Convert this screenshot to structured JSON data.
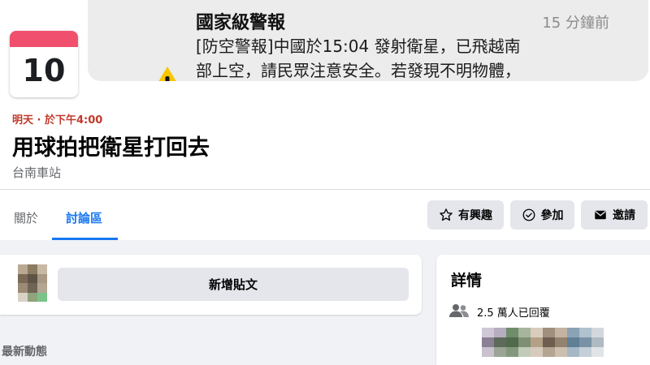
{
  "alert": {
    "title": "國家級警報",
    "time": "15 分鐘前",
    "line1": "[防空警報]中國於15:04 發射衛星，已飛越南",
    "line2": "部上空，請民眾注意安全。若發現不明物體，",
    "icon": "warning-icon"
  },
  "calendar": {
    "day": "10日",
    "accent": "#f0506e"
  },
  "event": {
    "when": "明天 · 於下午4:00",
    "title": "用球拍把衛星打回去",
    "location": "台南車站"
  },
  "tabs": [
    {
      "label": "關於",
      "active": false
    },
    {
      "label": "討論區",
      "active": true
    }
  ],
  "actions": [
    {
      "label": "有興趣",
      "icon": "star-icon"
    },
    {
      "label": "參加",
      "icon": "check-circle-icon"
    },
    {
      "label": "邀請",
      "icon": "envelope-icon"
    }
  ],
  "composer": {
    "button_label": "新增貼文"
  },
  "feed": {
    "heading": "最新動態"
  },
  "details": {
    "title": "詳情",
    "replied": "2.5 萬人已回覆",
    "icon": "people-icon"
  },
  "colors": {
    "accent": "#1877f2",
    "when_text": "#c0392b",
    "warning_yellow": "#f7c600",
    "button_bg": "#e4e6eb"
  }
}
